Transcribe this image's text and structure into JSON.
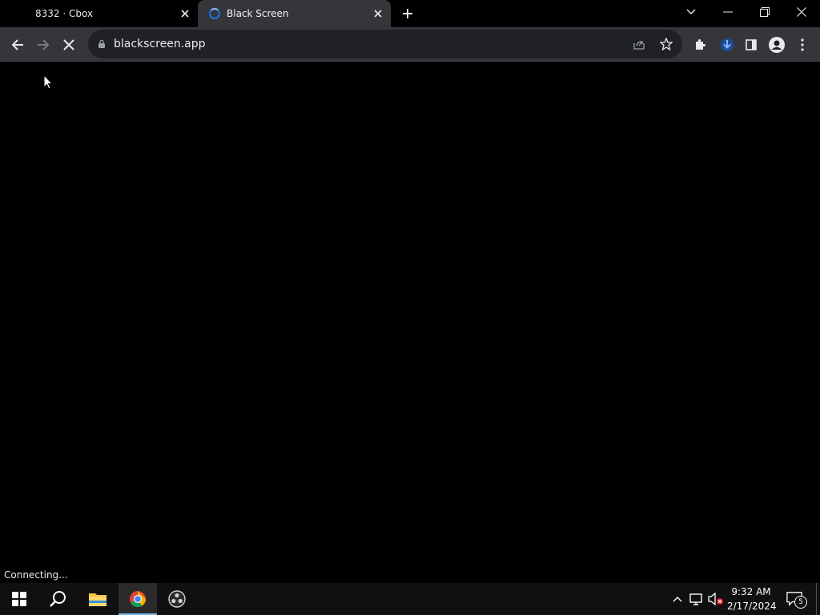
{
  "tabs": [
    {
      "title": "8332 · Cbox",
      "active": false
    },
    {
      "title": "Black Screen",
      "active": true
    }
  ],
  "address_bar": {
    "url": "blackscreen.app"
  },
  "status_bar": {
    "text": "Connecting..."
  },
  "taskbar": {
    "time": "9:32 AM",
    "date": "2/17/2024",
    "notification_count": "5"
  },
  "colors": {
    "page_bg": "#000000",
    "toolbar_bg": "#35363a",
    "accent": "#8ab4f8"
  }
}
